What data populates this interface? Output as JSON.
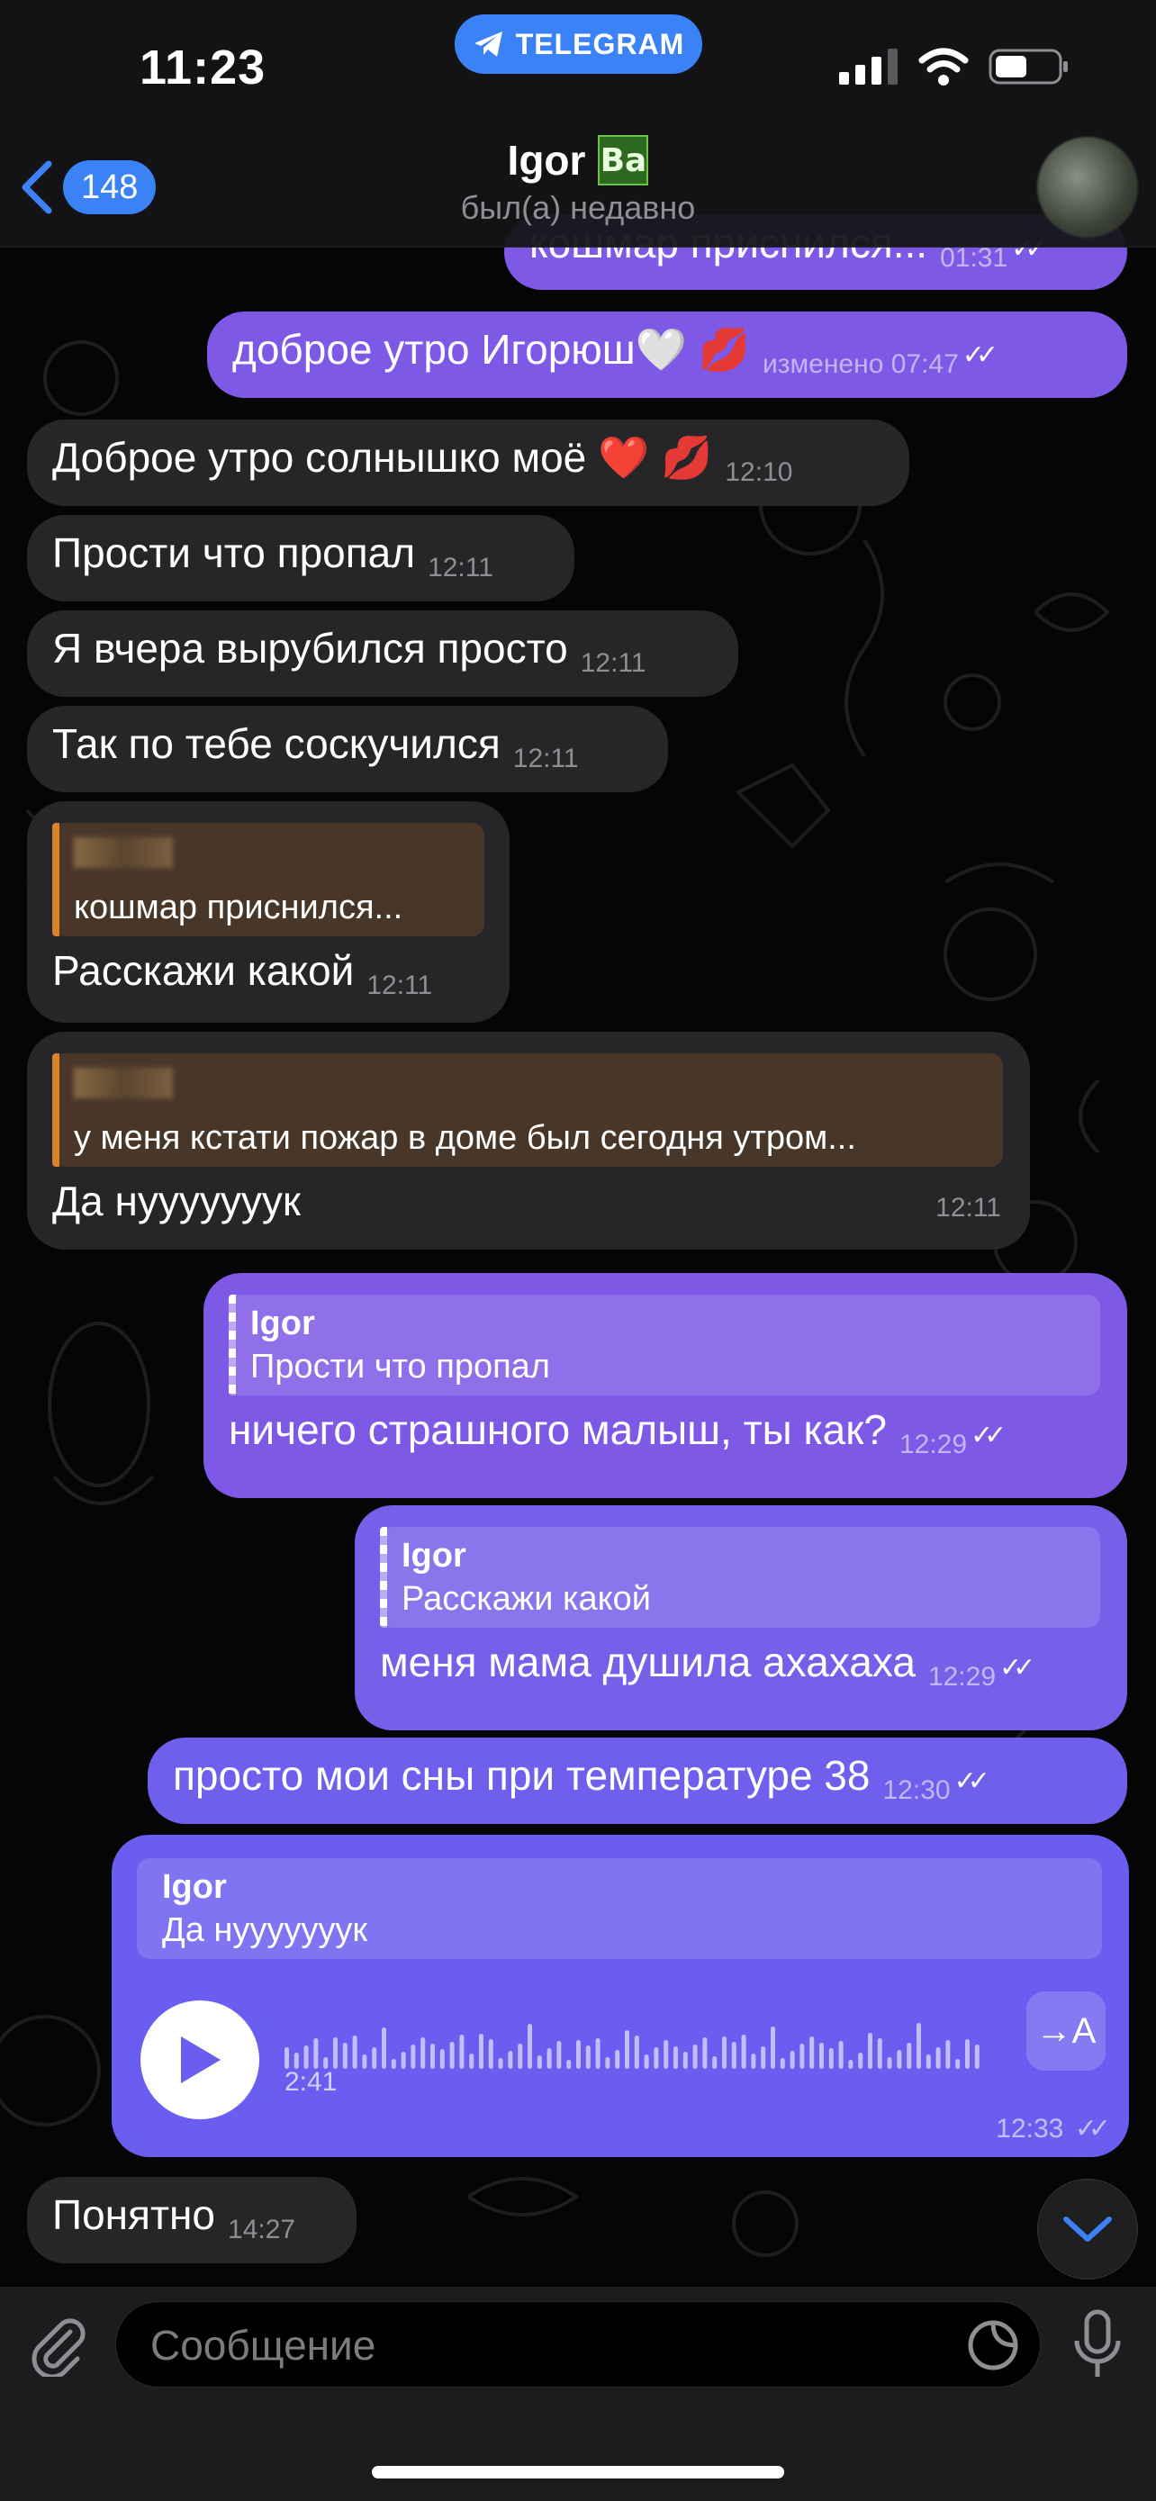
{
  "status_bar": {
    "time": "11:23",
    "app_pill": "TELEGRAM",
    "icons": [
      "signal-icon",
      "wifi-icon",
      "battery-icon"
    ]
  },
  "header": {
    "back_count": "148",
    "title": "Igor",
    "title_emoji_text": "Ba",
    "subtitle": "был(а) недавно"
  },
  "messages": [
    {
      "dir": "out",
      "text": "кошмар приснился...",
      "time": "01:31"
    },
    {
      "dir": "out",
      "text": "доброе утро Игорюш🤍 💋",
      "time": "изменено 07:47"
    },
    {
      "dir": "in",
      "text": "Доброе утро солнышко моё ❤️ 💋",
      "time": "12:10"
    },
    {
      "dir": "in",
      "text": "Прости что пропал",
      "time": "12:11"
    },
    {
      "dir": "in",
      "text": "Я вчера вырубился просто",
      "time": "12:11"
    },
    {
      "dir": "in",
      "text": "Так по тебе соскучился",
      "time": "12:11"
    },
    {
      "dir": "in",
      "reply_text": "кошмар приснился...",
      "text": "Расскажи какой",
      "time": "12:11"
    },
    {
      "dir": "in",
      "reply_text": "у меня кстати пожар в доме был сегодня утром...",
      "text": "Да нууууууук",
      "time": "12:11"
    },
    {
      "dir": "out",
      "reply_name": "Igor",
      "reply_text": "Прости что пропал",
      "text": "ничего страшного малыш, ты как?",
      "time": "12:29"
    },
    {
      "dir": "out",
      "reply_name": "Igor",
      "reply_text": "Расскажи какой",
      "text": "меня мама душила ахахаха",
      "time": "12:29"
    },
    {
      "dir": "out",
      "text": "просто мои сны при температуре 38",
      "time": "12:30"
    },
    {
      "dir": "in",
      "text": "Понятно",
      "time": "14:27"
    }
  ],
  "voice": {
    "reply_name": "Igor",
    "reply_text": "Да нууууууук",
    "duration": "2:41",
    "transcribe_label": "→A",
    "time": "12:33"
  },
  "input": {
    "placeholder": "Сообщение"
  },
  "colors": {
    "accent": "#3a82f6",
    "outgoing": "#7e59e6",
    "outgoing_voice": "#6a5ef0",
    "incoming": "#262628",
    "reply_bar_in": "#d9822b"
  }
}
